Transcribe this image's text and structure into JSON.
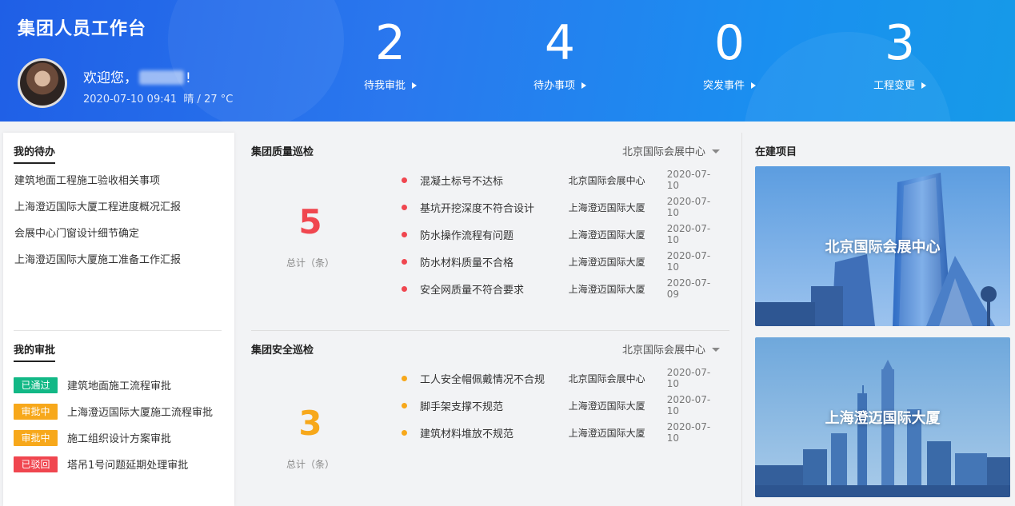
{
  "header": {
    "app_title": "集团人员工作台",
    "welcome_prefix": "欢迎您，",
    "welcome_suffix": "!",
    "datetime": "2020-07-10 09:41",
    "weather": "晴 / 27 °C",
    "stats": [
      {
        "value": "2",
        "label": "待我审批"
      },
      {
        "value": "4",
        "label": "待办事项"
      },
      {
        "value": "0",
        "label": "突发事件"
      },
      {
        "value": "3",
        "label": "工程变更"
      }
    ]
  },
  "todo": {
    "title": "我的待办",
    "items": [
      "建筑地面工程施工验收相关事项",
      "上海澄迈国际大厦工程进度概况汇报",
      "会展中心门窗设计细节确定",
      "上海澄迈国际大厦施工准备工作汇报"
    ]
  },
  "approvals": {
    "title": "我的审批",
    "items": [
      {
        "status": "已通过",
        "color": "#12b886",
        "text": "建筑地面施工流程审批"
      },
      {
        "status": "审批中",
        "color": "#f7a81b",
        "text": "上海澄迈国际大厦施工流程审批"
      },
      {
        "status": "审批中",
        "color": "#f7a81b",
        "text": "施工组织设计方案审批"
      },
      {
        "status": "已驳回",
        "color": "#f0464f",
        "text": "塔吊1号问题延期处理审批"
      }
    ]
  },
  "quality": {
    "title": "集团质量巡检",
    "site": "北京国际会展中心",
    "total": "5",
    "total_label": "总计（条）",
    "color": "#f0464f",
    "issues": [
      {
        "title": "混凝土标号不达标",
        "location": "北京国际会展中心",
        "date": "2020-07-10"
      },
      {
        "title": "基坑开挖深度不符合设计",
        "location": "上海澄迈国际大厦",
        "date": "2020-07-10"
      },
      {
        "title": "防水操作流程有问题",
        "location": "上海澄迈国际大厦",
        "date": "2020-07-10"
      },
      {
        "title": "防水材料质量不合格",
        "location": "上海澄迈国际大厦",
        "date": "2020-07-10"
      },
      {
        "title": "安全网质量不符合要求",
        "location": "上海澄迈国际大厦",
        "date": "2020-07-09"
      }
    ]
  },
  "safety": {
    "title": "集团安全巡检",
    "site": "北京国际会展中心",
    "total": "3",
    "total_label": "总计（条）",
    "color": "#f7a81b",
    "issues": [
      {
        "title": "工人安全帽佩戴情况不合规",
        "location": "北京国际会展中心",
        "date": "2020-07-10"
      },
      {
        "title": "脚手架支撑不规范",
        "location": "上海澄迈国际大厦",
        "date": "2020-07-10"
      },
      {
        "title": "建筑材料堆放不规范",
        "location": "上海澄迈国际大厦",
        "date": "2020-07-10"
      }
    ]
  },
  "projects": {
    "title": "在建项目",
    "items": [
      "北京国际会展中心",
      "上海澄迈国际大厦"
    ]
  }
}
